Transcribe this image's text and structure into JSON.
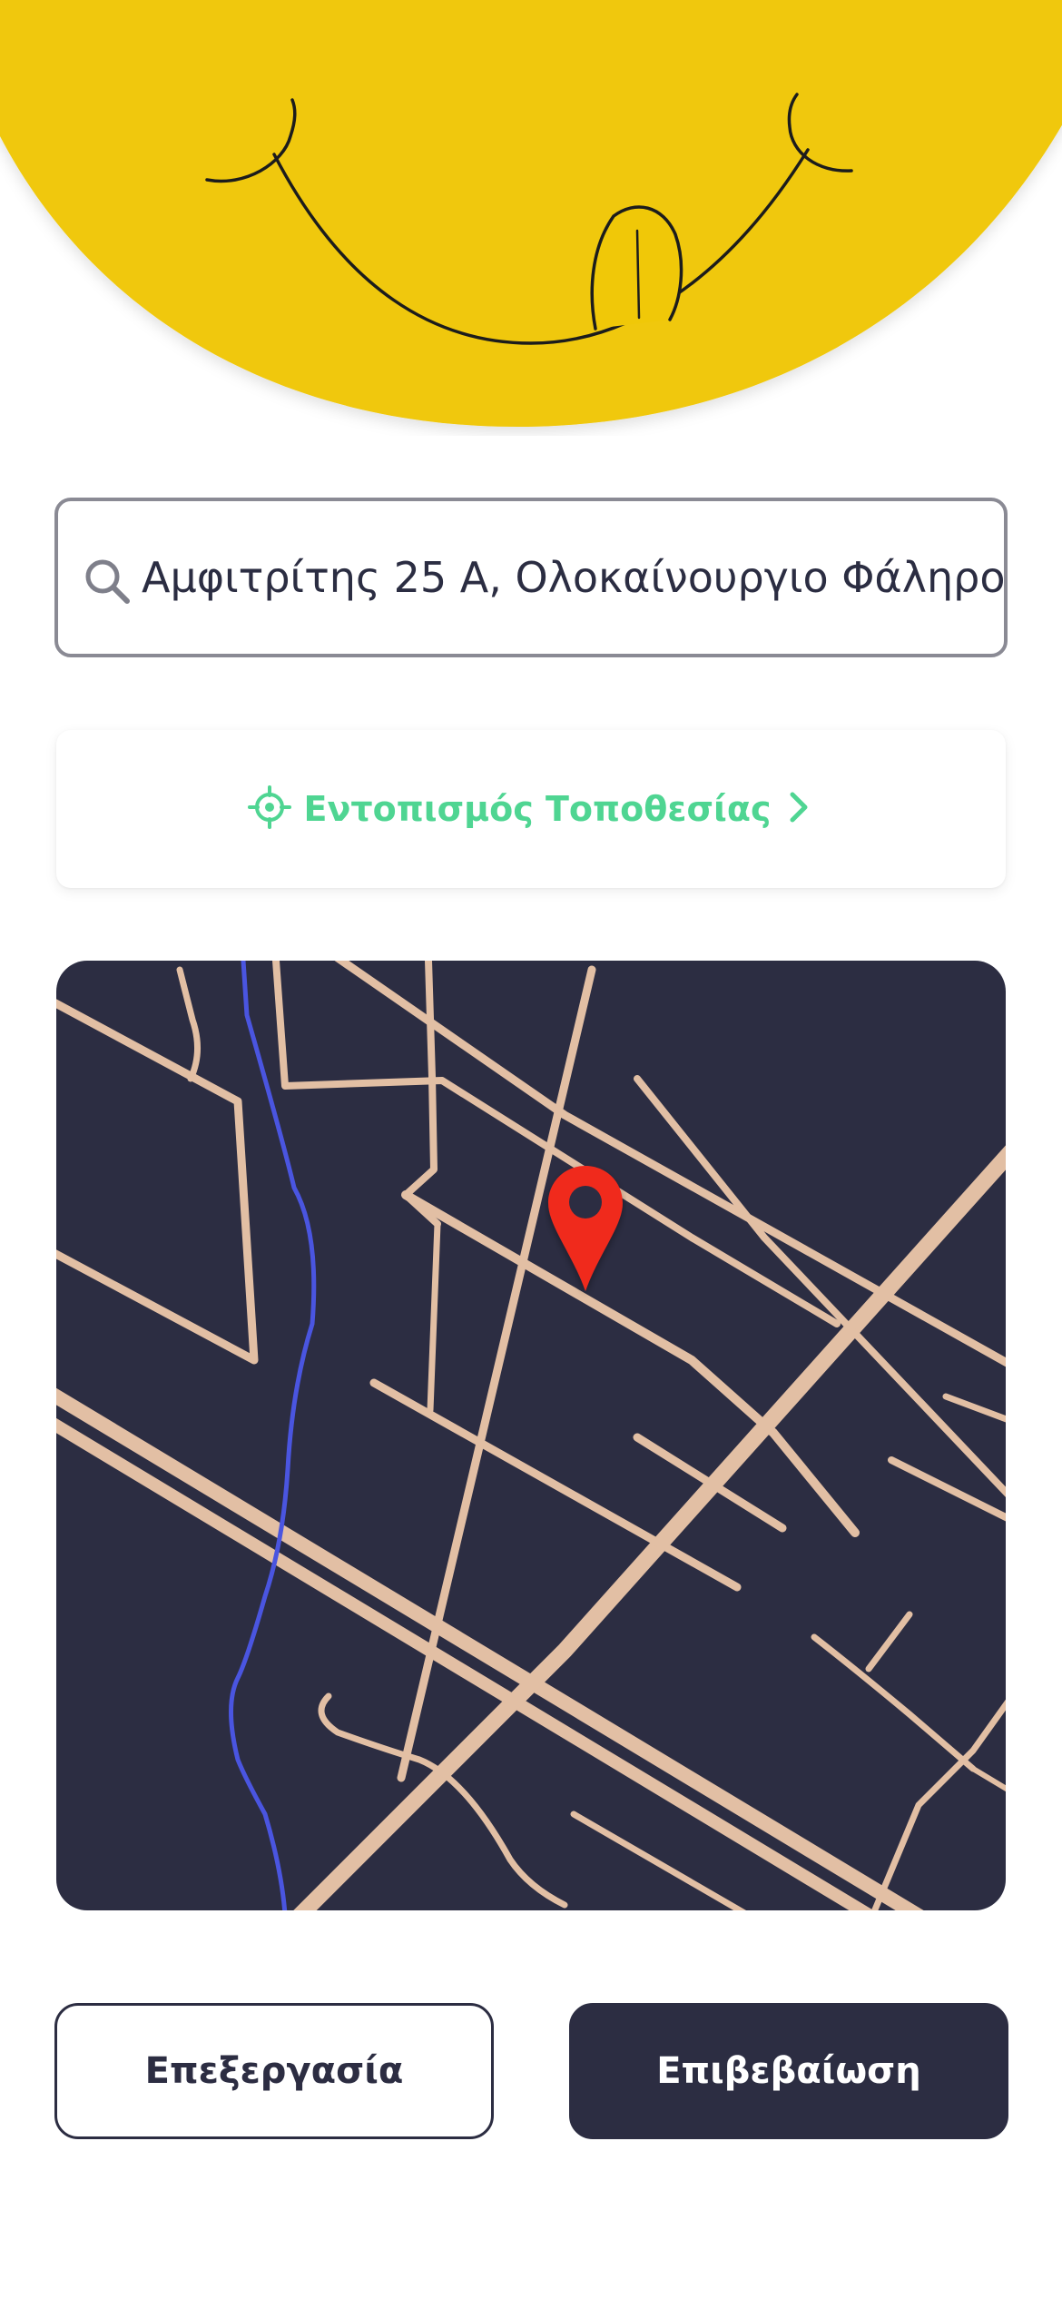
{
  "hero": {
    "icon": "smiley-face-illustration",
    "color": "#f0c808"
  },
  "search": {
    "value": "Αμφιτρίτης 25 Α, Ολοκαίνουργιο Φάληρο",
    "icon": "search-icon"
  },
  "locate": {
    "label": "Εντοπισμός Τοποθεσίας",
    "icon": "crosshair-icon",
    "chevron": "chevron-right-icon",
    "color": "#4fd592"
  },
  "map": {
    "background": "#2c2d42",
    "road_color": "#e2bfa4",
    "river_color": "#4a55e0",
    "pin": "map-pin-icon",
    "pin_color": "#f02a1e"
  },
  "actions": {
    "edit_label": "Επεξεργασία",
    "confirm_label": "Επιβεβαίωση"
  }
}
